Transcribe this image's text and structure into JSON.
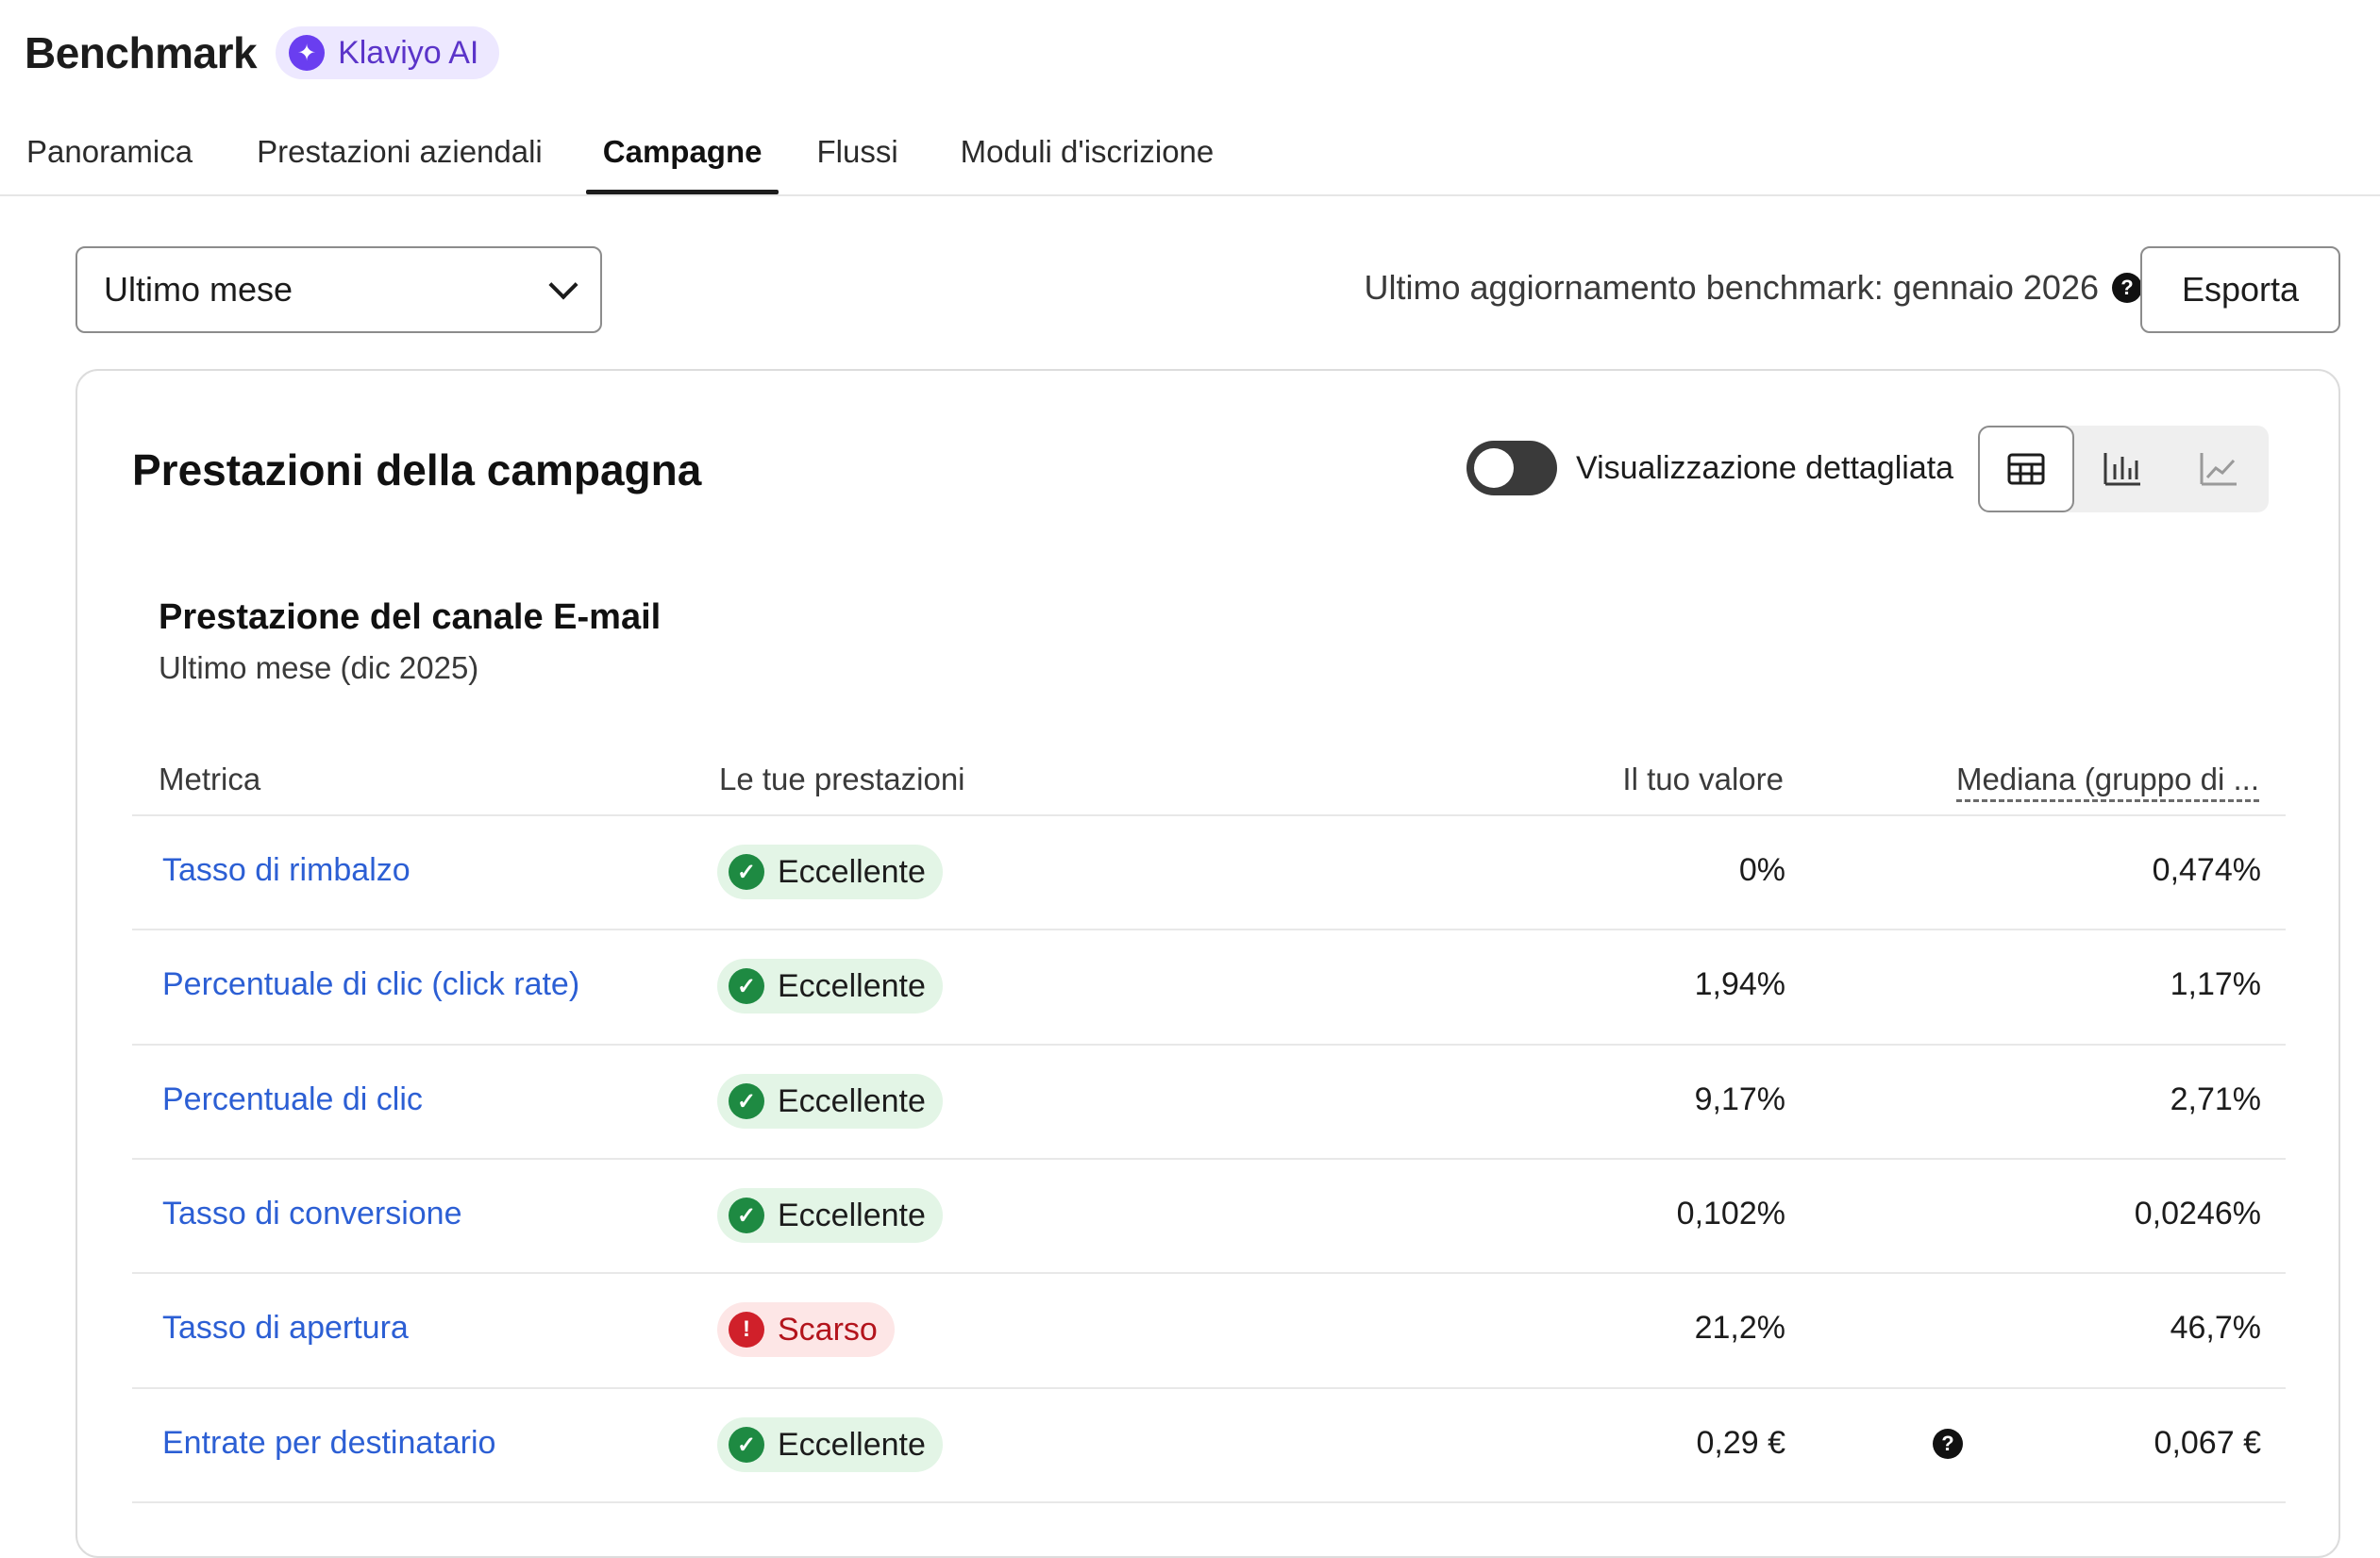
{
  "header": {
    "title": "Benchmark",
    "ai_badge": "Klaviyo AI"
  },
  "tabs": [
    {
      "label": "Panoramica",
      "active": false
    },
    {
      "label": "Prestazioni aziendali",
      "active": false
    },
    {
      "label": "Campagne",
      "active": true
    },
    {
      "label": "Flussi",
      "active": false
    },
    {
      "label": "Moduli d'iscrizione",
      "active": false
    }
  ],
  "filters": {
    "period_selected": "Ultimo mese",
    "last_update": "Ultimo aggiornamento benchmark: gennaio 2026",
    "export_label": "Esporta"
  },
  "card": {
    "title": "Prestazioni della campagna",
    "toggle_label": "Visualizzazione dettagliata",
    "toggle_on": false,
    "view_options": [
      "table-icon",
      "bar-chart-icon",
      "line-chart-icon"
    ],
    "active_view": "table-icon"
  },
  "section": {
    "title": "Prestazione del canale E-mail",
    "period": "Ultimo mese (dic 2025)"
  },
  "table": {
    "headers": {
      "metric": "Metrica",
      "performance": "Le tue prestazioni",
      "value": "Il tuo valore",
      "median": "Mediana (gruppo di ..."
    },
    "rows": [
      {
        "metric": "Tasso di rimbalzo",
        "status": "Eccellente",
        "status_type": "good",
        "value": "0%",
        "median": "0,474%",
        "help": false
      },
      {
        "metric": "Percentuale di clic (click rate)",
        "status": "Eccellente",
        "status_type": "good",
        "value": "1,94%",
        "median": "1,17%",
        "help": false
      },
      {
        "metric": "Percentuale di clic",
        "status": "Eccellente",
        "status_type": "good",
        "value": "9,17%",
        "median": "2,71%",
        "help": false
      },
      {
        "metric": "Tasso di conversione",
        "status": "Eccellente",
        "status_type": "good",
        "value": "0,102%",
        "median": "0,0246%",
        "help": false
      },
      {
        "metric": "Tasso di apertura",
        "status": "Scarso",
        "status_type": "poor",
        "value": "21,2%",
        "median": "46,7%",
        "help": false
      },
      {
        "metric": "Entrate per destinatario",
        "status": "Eccellente",
        "status_type": "good",
        "value": "0,29 €",
        "median": "0,067 €",
        "help": true
      }
    ]
  },
  "colors": {
    "link": "#2c5fd4",
    "good_bg": "#e3f5e6",
    "good_icon": "#1e8a42",
    "poor_bg": "#fde6e6",
    "poor_icon": "#d0202a",
    "ai_accent": "#6a3ef0"
  }
}
